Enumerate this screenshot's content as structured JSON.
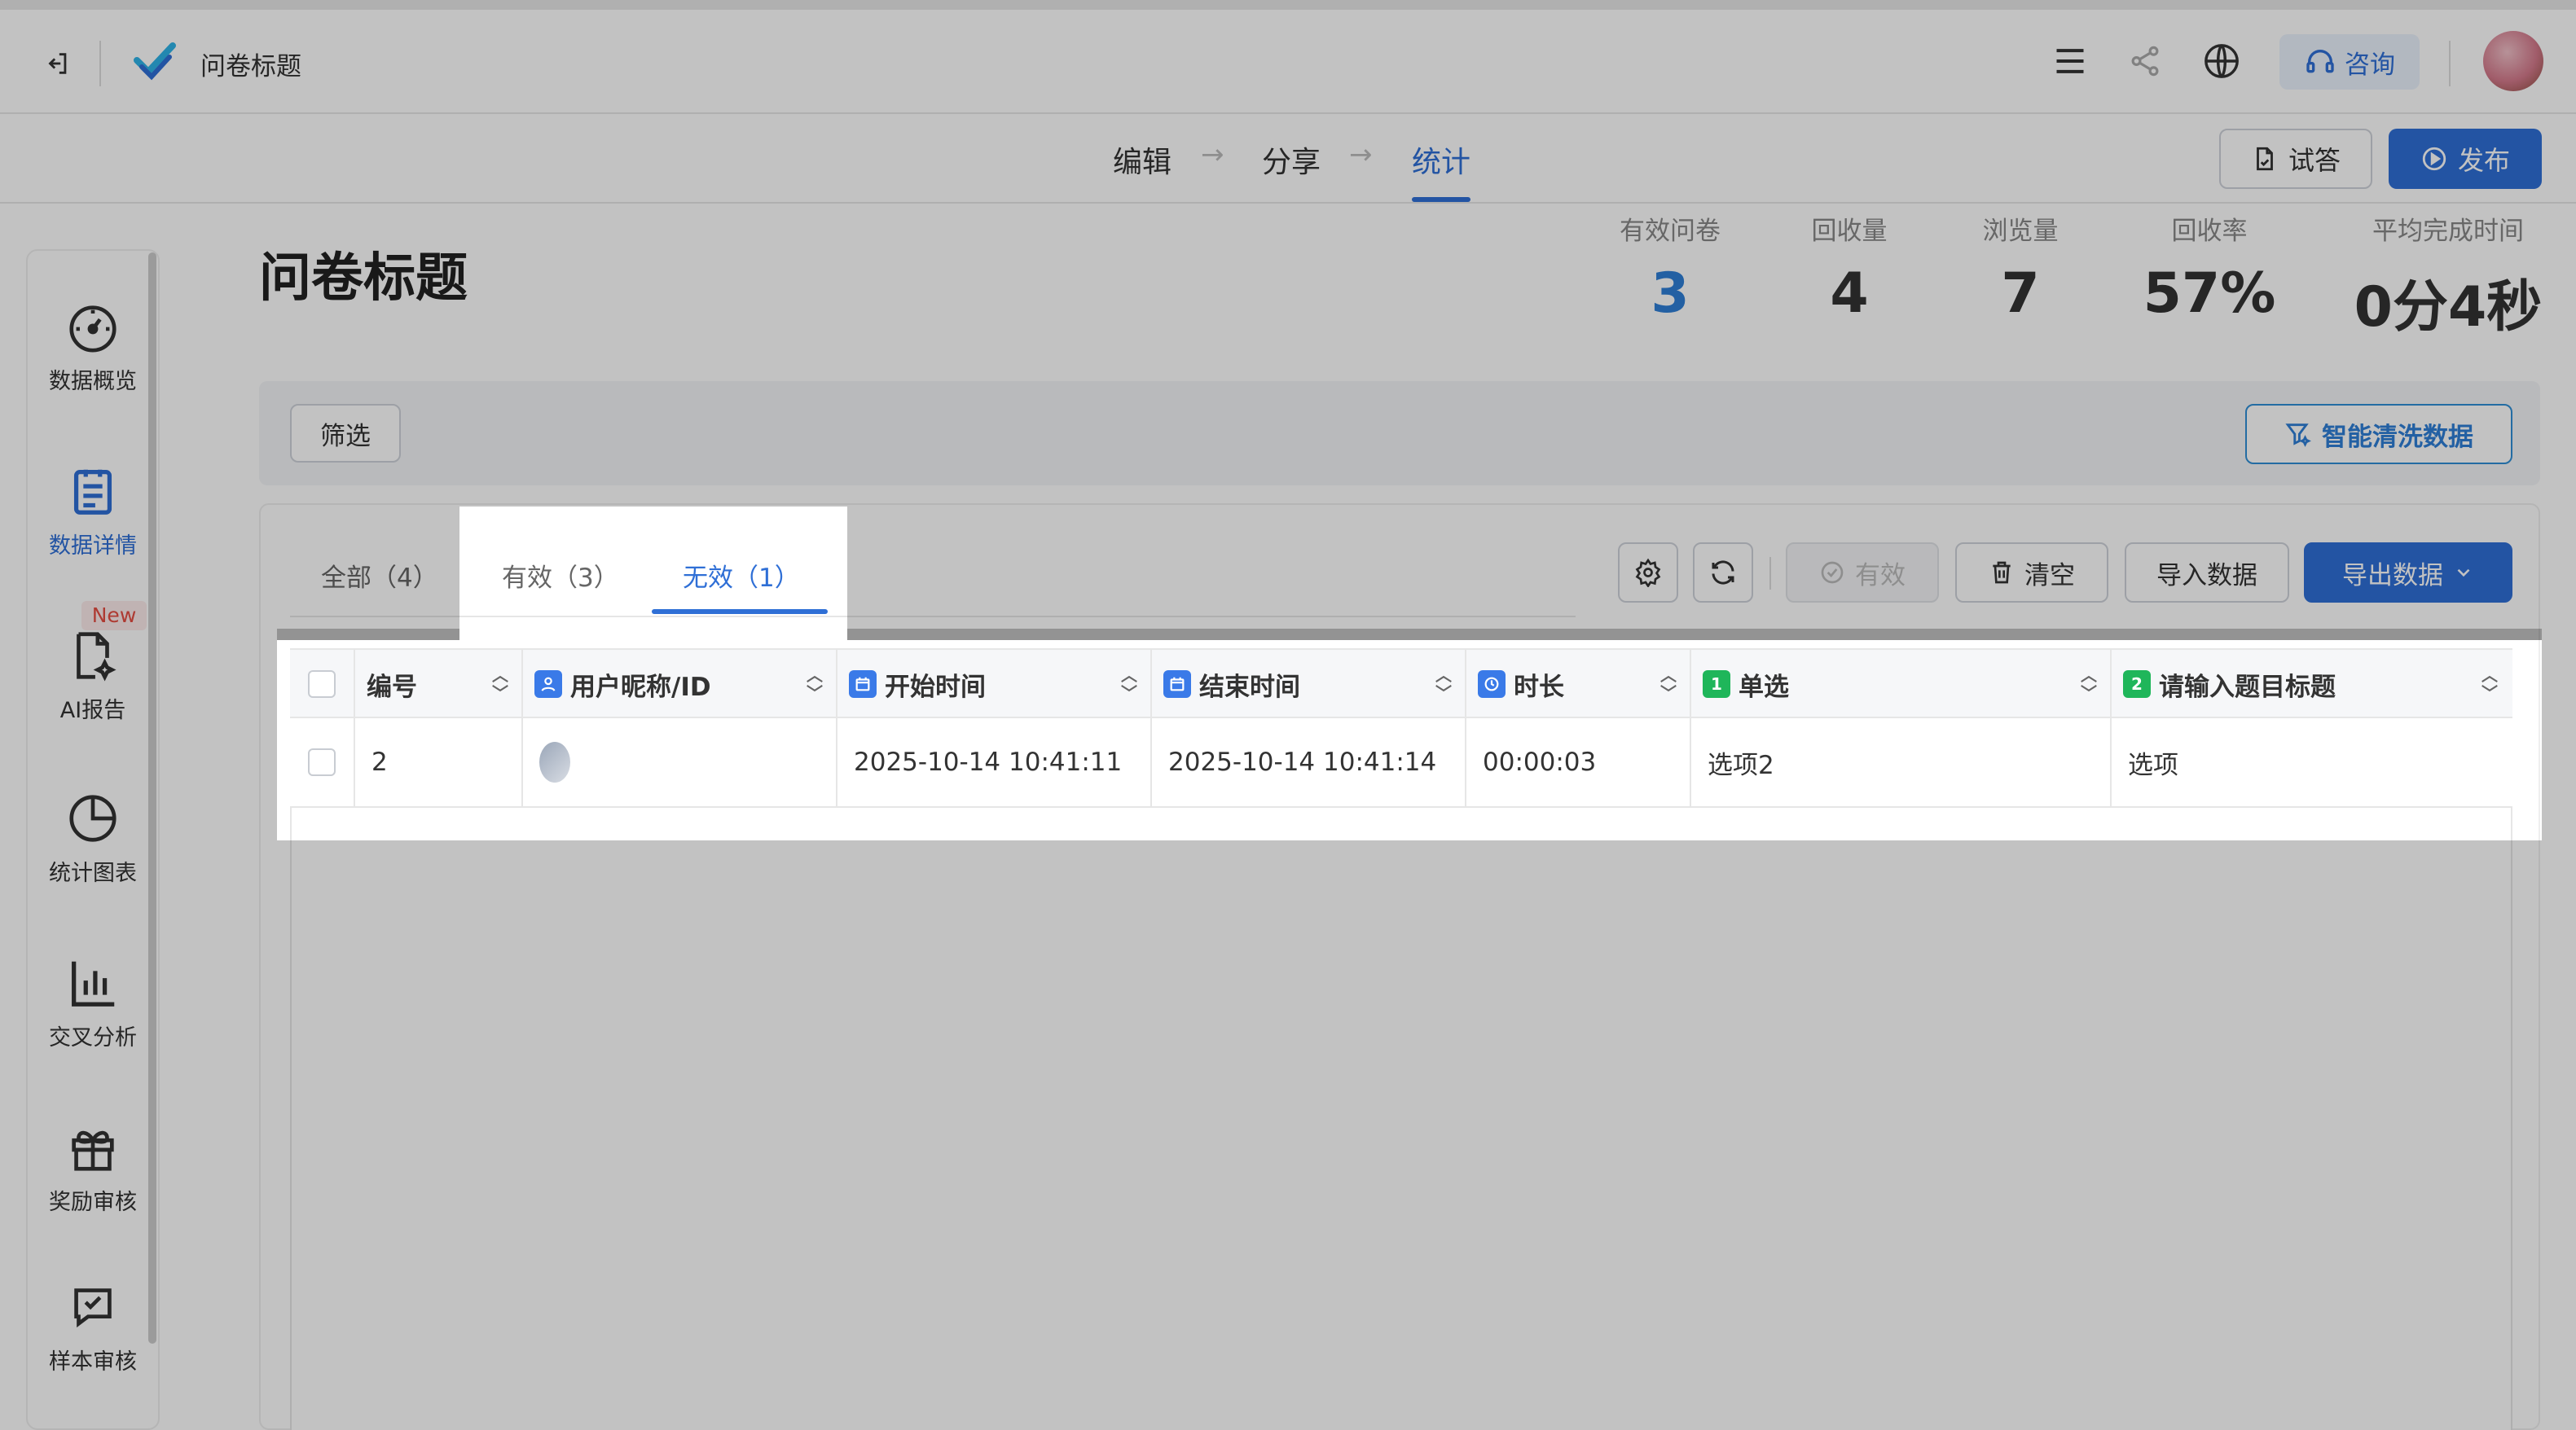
{
  "app": {
    "title": "问卷标题"
  },
  "header": {
    "consult_label": "咨询"
  },
  "steps": [
    {
      "label": "编辑"
    },
    {
      "label": "分享"
    },
    {
      "label": "统计"
    }
  ],
  "step_arrow": "→",
  "actions": {
    "try_label": "试答",
    "publish_label": "发布"
  },
  "sidebar": {
    "items": [
      {
        "label": "数据概览",
        "icon": "dashboard-icon"
      },
      {
        "label": "数据详情",
        "icon": "clipboard-icon"
      },
      {
        "label": "AI报告",
        "icon": "ai-report-icon",
        "badge": "New"
      },
      {
        "label": "统计图表",
        "icon": "pie-chart-icon"
      },
      {
        "label": "交叉分析",
        "icon": "bar-chart-icon"
      },
      {
        "label": "奖励审核",
        "icon": "gift-icon"
      },
      {
        "label": "样本审核",
        "icon": "check-message-icon"
      }
    ]
  },
  "main": {
    "heading": "问卷标题",
    "stats": [
      {
        "label": "有效问卷",
        "value": "3"
      },
      {
        "label": "回收量",
        "value": "4"
      },
      {
        "label": "浏览量",
        "value": "7"
      },
      {
        "label": "回收率",
        "value": "57%"
      },
      {
        "label": "平均完成时间",
        "value": "0分4秒"
      }
    ],
    "filter_label": "筛选",
    "clean_label": "智能清洗数据",
    "tabs": [
      {
        "label": "全部（4）"
      },
      {
        "label": "有效（3）"
      },
      {
        "label": "无效（1）"
      }
    ],
    "toolbar": {
      "valid_label": "有效",
      "clear_label": "清空",
      "import_label": "导入数据",
      "export_label": "导出数据"
    },
    "table": {
      "columns": [
        "编号",
        "用户昵称/ID",
        "开始时间",
        "结束时间",
        "时长",
        "单选",
        "请输入题目标题"
      ],
      "column_badges": [
        "1",
        "2"
      ],
      "rows": [
        {
          "id": "2",
          "user": "",
          "start": "2025-10-14 10:41:11",
          "end": "2025-10-14 10:41:14",
          "duration": "00:00:03",
          "q1": "选项2",
          "q2": "选项"
        }
      ]
    }
  },
  "colors": {
    "accent": "#2f6fd6",
    "green": "#1fb65a",
    "badge_red": "#e54d42"
  }
}
